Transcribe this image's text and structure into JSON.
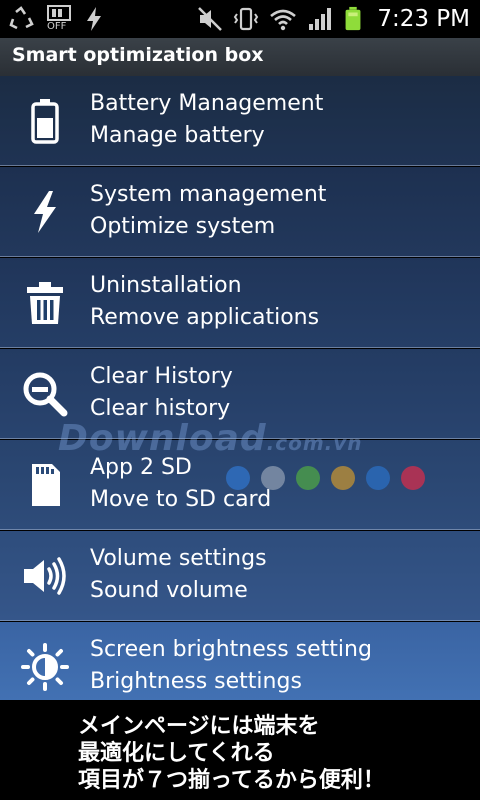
{
  "status_bar": {
    "time": "7:23 PM",
    "off_label": "OFF",
    "left_icons": [
      "recycle-icon",
      "storage-off-icon",
      "flash-icon"
    ],
    "right_icons": [
      "mute-icon",
      "vibrate-icon",
      "wifi-icon",
      "signal-icon",
      "battery-icon"
    ]
  },
  "title_bar": {
    "title": "Smart optimization box"
  },
  "menu": {
    "items": [
      {
        "title": "Battery Management",
        "subtitle": "Manage battery",
        "icon": "battery-icon",
        "bg_top": "#1b2c44",
        "bg_bottom": "#1f3353"
      },
      {
        "title": "System management",
        "subtitle": "Optimize system",
        "icon": "lightning-icon",
        "bg_top": "#1d3050",
        "bg_bottom": "#22385c"
      },
      {
        "title": "Uninstallation",
        "subtitle": "Remove applications",
        "icon": "trash-icon",
        "bg_top": "#203559",
        "bg_bottom": "#253e66"
      },
      {
        "title": "Clear History",
        "subtitle": "Clear history",
        "icon": "zoom-out-icon",
        "bg_top": "#233b62",
        "bg_bottom": "#29446f"
      },
      {
        "title": "App 2 SD",
        "subtitle": "Move to SD card",
        "icon": "sd-card-icon",
        "bg_top": "#28436d",
        "bg_bottom": "#2e4c7a"
      },
      {
        "title": "Volume settings",
        "subtitle": "Sound volume",
        "icon": "volume-icon",
        "bg_top": "#2e4d7c",
        "bg_bottom": "#35568a"
      },
      {
        "title": "Screen brightness setting",
        "subtitle": "Brightness settings",
        "icon": "brightness-icon",
        "bg_top": "#3a64a3",
        "bg_bottom": "#4271b3"
      }
    ]
  },
  "watermark": {
    "text": "Download",
    "suffix": ".com.vn",
    "dot_colors": [
      "#2f6fc0",
      "#8090a8",
      "#4a9a4a",
      "#b08a3a",
      "#2a6ab8",
      "#c03050"
    ]
  },
  "banner": {
    "lines": [
      "メインページには端末を",
      "最適化にしてくれる",
      "項目が７つ揃ってるから便利！"
    ]
  }
}
